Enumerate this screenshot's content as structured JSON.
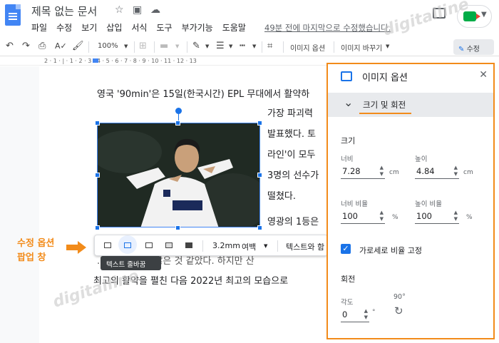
{
  "header": {
    "doc_title": "제목 없는 문서",
    "menu": [
      "파일",
      "수정",
      "보기",
      "삽입",
      "서식",
      "도구",
      "부가기능",
      "도움말"
    ],
    "last_edit": "49분 전에 마지막으로 수정했습니다."
  },
  "toolbar": {
    "zoom": "100%",
    "image_options_label": "이미지 옵션",
    "replace_image_label": "이미지 바꾸기",
    "edit_mode_label": "수정"
  },
  "ruler": {
    "numbers": "2 · 1 · | · 1 · 2 · 3 · 4 · 5 · 6 · 7 · 8 · 9 · 10 · 11 · 12 · 13"
  },
  "document": {
    "lines": [
      "영국 '90min'은 15일(한국시간) EPL 무대에서 활약하",
      "가장 파괴력",
      "발표했다. 토",
      "라인'이 모두",
      "3명의 선수가",
      "떨쳤다.",
      "영광의 1등은",
      "...모습이 꾀지 않은 것 같았다. 하지만 산",
      "최고의 활약을 펼친 다음 2022년 최고의 모습으로"
    ]
  },
  "image_popup": {
    "margin_value": "3.2mm",
    "margin_label": "여백",
    "text_option": "텍스트와 함",
    "tooltip": "텍스트 줄바꿈"
  },
  "annotation": {
    "line1": "수정 옵션",
    "line2": "팝업 창"
  },
  "side_panel": {
    "title": "이미지 옵션",
    "section": "크기 및 회전",
    "size_heading": "크기",
    "width_label": "너비",
    "width_value": "7.28",
    "height_label": "높이",
    "height_value": "4.84",
    "unit_cm": "cm",
    "width_ratio_label": "너비 비율",
    "width_ratio_value": "100",
    "height_ratio_label": "높이 비율",
    "height_ratio_value": "100",
    "unit_percent": "%",
    "lock_ratio_label": "가로세로 비율 고정",
    "rotation_heading": "회전",
    "angle_label": "각도",
    "angle_value": "0",
    "unit_degree": "°",
    "rotate90_label": "90°"
  },
  "watermark": {
    "text": "digitalline"
  },
  "colors": {
    "accent_blue": "#1a73e8",
    "highlight_orange": "#f28b1a"
  }
}
